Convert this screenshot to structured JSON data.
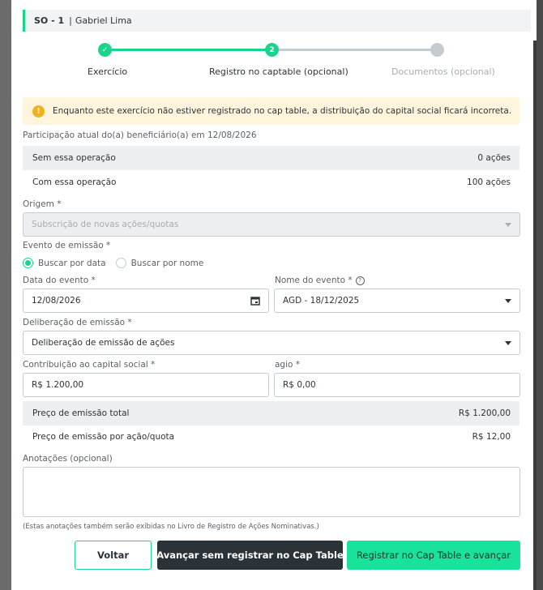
{
  "header": {
    "code": "SO - 1",
    "separator": "|",
    "name": "Gabriel Lima"
  },
  "stepper": {
    "steps": [
      {
        "label": "Exercício",
        "state": "done",
        "marker": "✓"
      },
      {
        "label": "Registro no captable (opcional)",
        "state": "current",
        "marker": "2"
      },
      {
        "label": "Documentos (opcional)",
        "state": "pending",
        "marker": ""
      }
    ]
  },
  "warning": {
    "icon": "!",
    "text": "Enquanto este exercício não estiver registrado no cap table, a distribuição do capital social ficará incorreta."
  },
  "participation": {
    "title": "Participação atual do(a) beneficiário(a) em 12/08/2026",
    "without_label": "Sem essa operação",
    "without_value": "0 ações",
    "with_label": "Com essa operação",
    "with_value": "100 ações"
  },
  "origin": {
    "label": "Origem *",
    "value": "Subscrição de novas ações/quotas"
  },
  "event": {
    "label": "Evento de emissão *",
    "radio_date": "Buscar por data",
    "radio_name": "Buscar por nome",
    "date_label": "Data do evento *",
    "date_value": "12/08/2026",
    "name_label": "Nome do evento *",
    "name_help": "?",
    "name_value": "AGD - 18/12/2025"
  },
  "deliberation": {
    "label": "Deliberação de emissão *",
    "value": "Deliberação de emissão de ações"
  },
  "contribution": {
    "label": "Contribuição ao capital social *",
    "value": "R$ 1.200,00"
  },
  "agio": {
    "label": "agio *",
    "value": "R$ 0,00"
  },
  "price": {
    "total_label": "Preço de emissão total",
    "total_value": "R$ 1.200,00",
    "per_share_label": "Preço de emissão por ação/quota",
    "per_share_value": "R$ 12,00"
  },
  "notes": {
    "label": "Anotações (opcional)",
    "value": "",
    "hint": "(Estas anotações também serão exibidas no Livro de Registro de Ações Nominativas.)"
  },
  "buttons": {
    "back": "Voltar",
    "skip": "Avançar sem registrar no Cap Table",
    "primary": "Registrar no Cap Table e avançar"
  },
  "colors": {
    "accent": "#19d48b",
    "primary_button": "#19e39a",
    "dark_button": "#2c3338",
    "warning_bg": "#fff5dc",
    "warning_icon": "#f2b01e"
  }
}
